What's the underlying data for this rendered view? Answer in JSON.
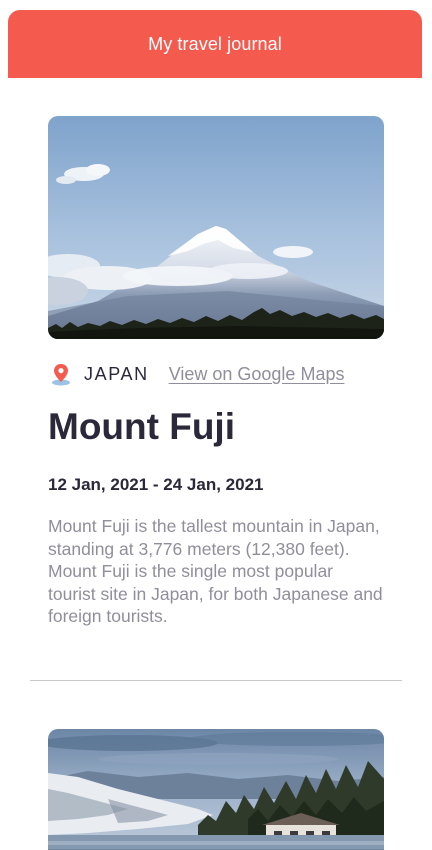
{
  "header": {
    "title": "My travel journal",
    "accent_color": "#F55A4E"
  },
  "entries": [
    {
      "image_icon": "mountain-photo",
      "location": "JAPAN",
      "location_icon": "map-pin-icon",
      "maps_link": "View on Google Maps",
      "title": "Mount Fuji",
      "dates": "12 Jan, 2021 - 24 Jan, 2021",
      "description": "Mount Fuji is the tallest mountain in Japan, standing at 3,776 meters (12,380 feet). Mount Fuji is the single most popular tourist site in Japan, for both Japanese and foreign tourists."
    },
    {
      "image_icon": "snowy-lake-photo"
    }
  ]
}
